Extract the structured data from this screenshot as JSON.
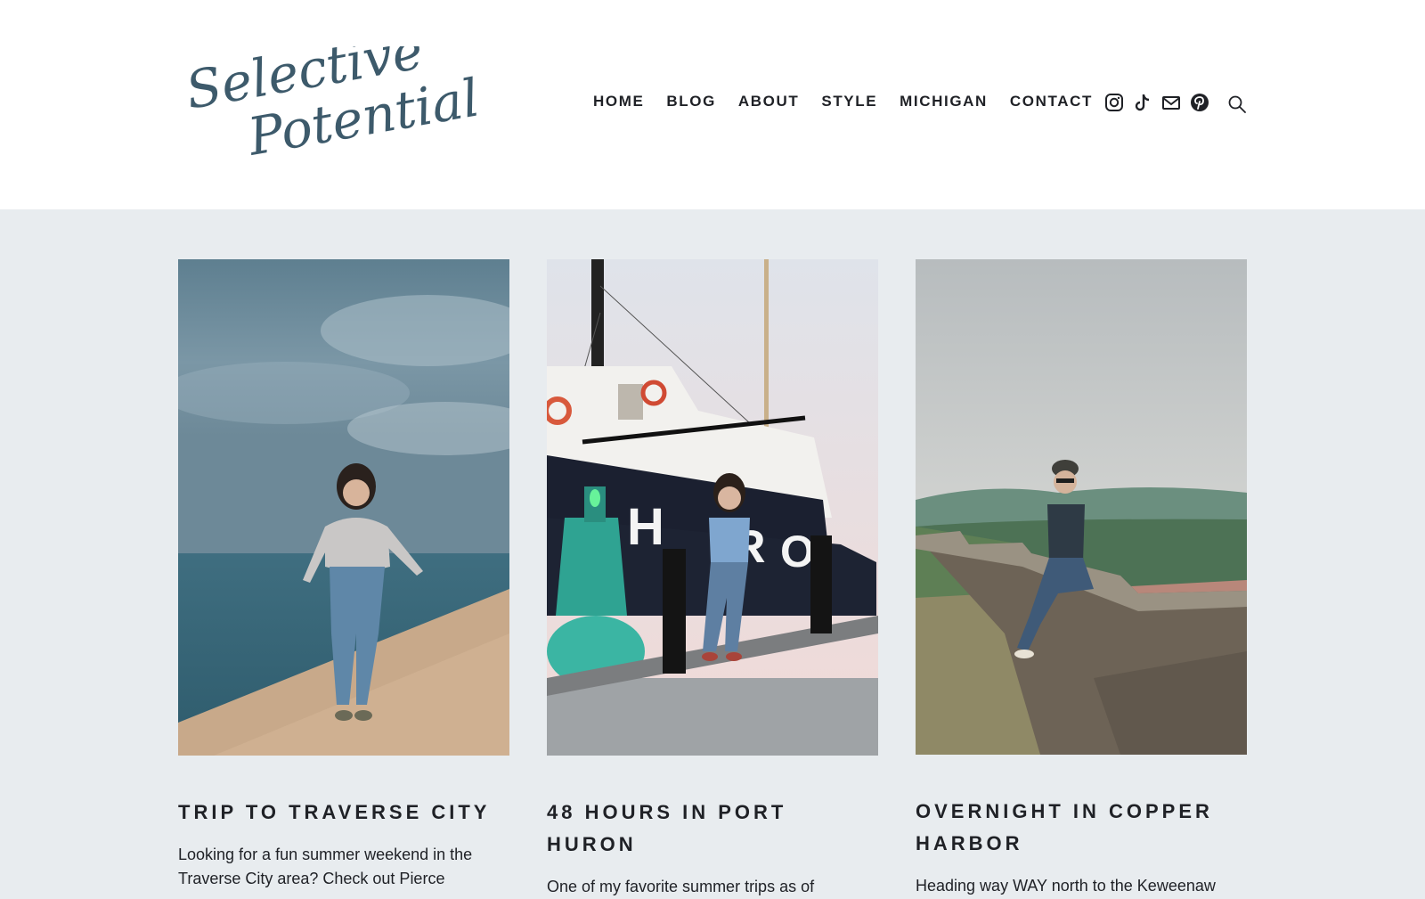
{
  "logo": {
    "line1": "Selective",
    "line2": "Potential"
  },
  "nav": [
    "HOME",
    "BLOG",
    "ABOUT",
    "STYLE",
    "MICHIGAN",
    "CONTACT"
  ],
  "social_icons": [
    "instagram-icon",
    "tiktok-icon",
    "email-icon",
    "pinterest-icon"
  ],
  "search_icon": "search-icon",
  "colors": {
    "header_bg": "#ffffff",
    "page_bg": "#e8ecef",
    "logo": "#3d5a6b",
    "text": "#1f2126"
  },
  "posts": [
    {
      "title": "TRIP TO TRAVERSE CITY",
      "excerpt": "Looking for a fun summer weekend in the Traverse City area? Check out Pierce",
      "image": "woman walking down sand dune by lake under cloudy sky"
    },
    {
      "title": "48 HOURS IN PORT HURON",
      "excerpt": "One of my favorite summer trips as of",
      "image": "woman leaning on post in front of Huron lightship"
    },
    {
      "title": "OVERNIGHT IN COPPER HARBOR",
      "excerpt": "Heading way WAY north to the Keweenaw",
      "image": "woman sitting on stone wall overlooking forest"
    }
  ]
}
